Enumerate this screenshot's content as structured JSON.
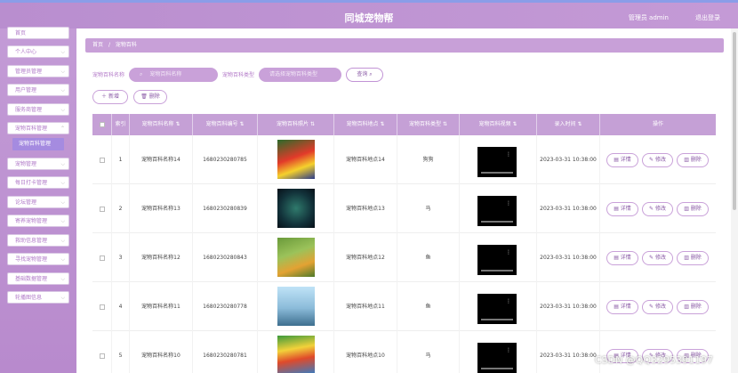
{
  "header": {
    "title": "同城宠物帮",
    "user": "管理员 admin",
    "logout": "退出登录"
  },
  "sidebar": {
    "items": [
      {
        "label": "首页"
      },
      {
        "label": "个人中心"
      },
      {
        "label": "管理员管理"
      },
      {
        "label": "用户管理"
      },
      {
        "label": "服务商管理"
      },
      {
        "label": "宠物百科管理"
      },
      {
        "label": "宠物管理"
      },
      {
        "label": "每日打卡管理"
      },
      {
        "label": "论坛管理"
      },
      {
        "label": "寄养宠物管理"
      },
      {
        "label": "救助信息管理"
      },
      {
        "label": "寻找宠物管理"
      },
      {
        "label": "基础数据管理"
      },
      {
        "label": "轮播图信息"
      }
    ],
    "active_sub": "宠物百科管理"
  },
  "breadcrumb": {
    "home": "首页",
    "sep": "/",
    "current": "宠物百科"
  },
  "search": {
    "name_label": "宠物百科名称",
    "name_placeholder": "宠物百科名称",
    "type_label": "宠物百科类型",
    "type_placeholder": "请选择宠物百科类型",
    "query": "查询"
  },
  "actions": {
    "add": "新增",
    "delete": "删除"
  },
  "table": {
    "headers": [
      "索引",
      "宠物百科名称",
      "宠物百科编号",
      "宠物百科照片",
      "宠物百科地点",
      "宠物百科类型",
      "宠物百科视频",
      "录入时间",
      "操作"
    ],
    "op_labels": {
      "detail": "详情",
      "edit": "修改",
      "delete": "删除"
    },
    "rows": [
      {
        "index": "1",
        "name": "宠物百科名称14",
        "code": "1680230280785",
        "place": "宠物百科地点14",
        "type": "狗狗",
        "time": "2023-03-31 10:38:00"
      },
      {
        "index": "2",
        "name": "宠物百科名称13",
        "code": "1680230280839",
        "place": "宠物百科地点13",
        "type": "马",
        "time": "2023-03-31 10:38:00"
      },
      {
        "index": "3",
        "name": "宠物百科名称12",
        "code": "1680230280843",
        "place": "宠物百科地点12",
        "type": "鱼",
        "time": "2023-03-31 10:38:00"
      },
      {
        "index": "4",
        "name": "宠物百科名称11",
        "code": "1680230280778",
        "place": "宠物百科地点11",
        "type": "鱼",
        "time": "2023-03-31 10:38:00"
      },
      {
        "index": "5",
        "name": "宠物百科名称10",
        "code": "1680230280781",
        "place": "宠物百科地点10",
        "type": "马",
        "time": "2023-03-31 10:38:00"
      }
    ]
  },
  "watermark": "CSDN @QQ3295391197",
  "colors": {
    "accent": "#c5a0d6",
    "header": "#b98ecf",
    "active": "#a58be0"
  }
}
